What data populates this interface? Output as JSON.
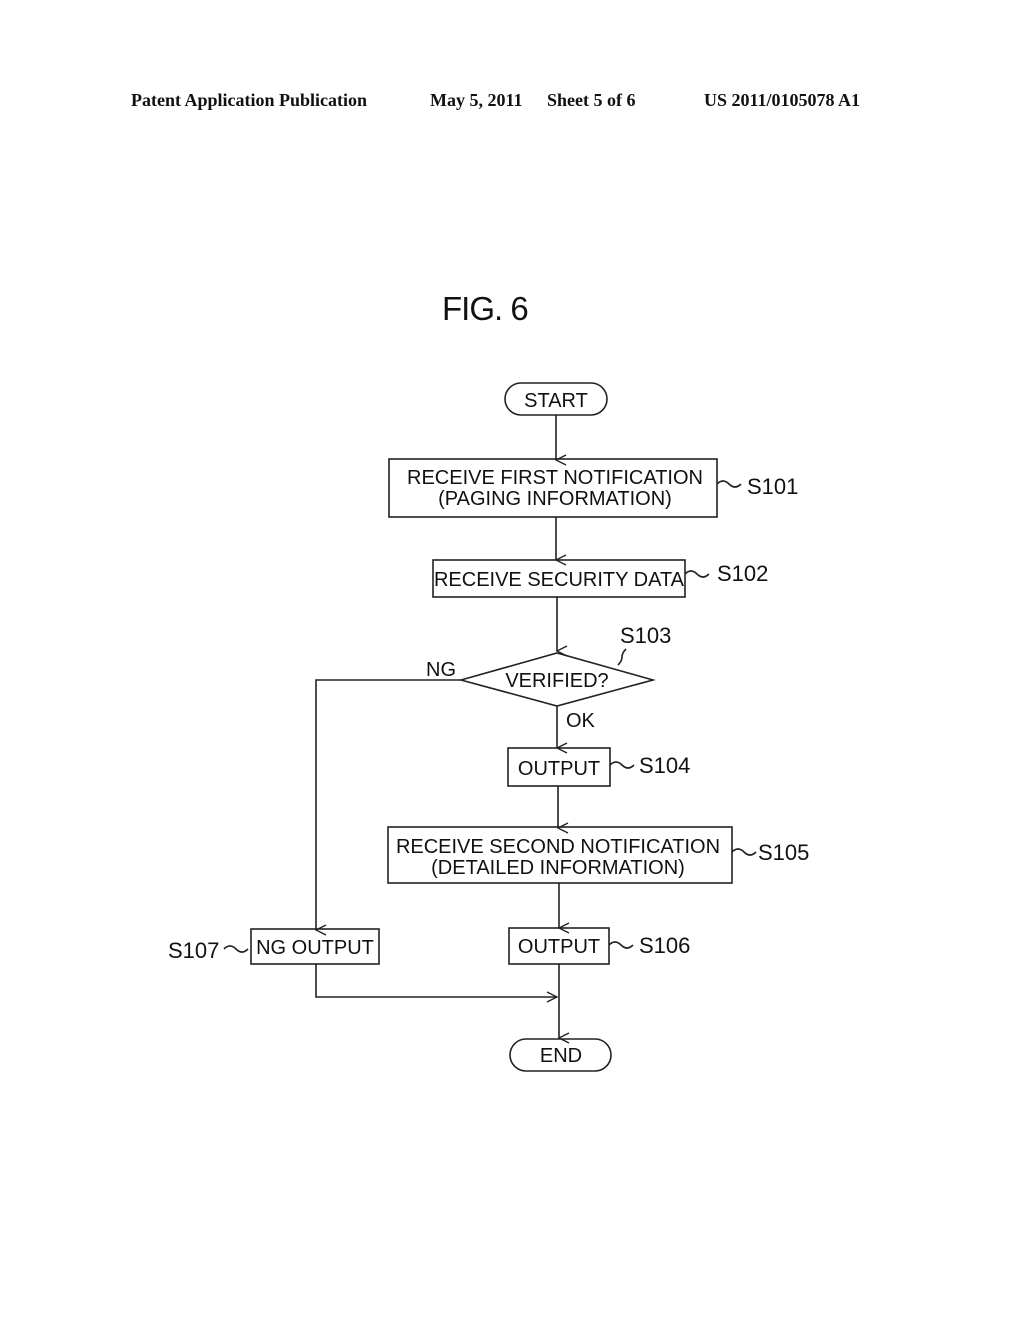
{
  "header": {
    "publication": "Patent Application Publication",
    "date": "May 5, 2011",
    "sheet": "Sheet 5 of 6",
    "number": "US 2011/0105078 A1"
  },
  "figure": {
    "title": "FIG. 6"
  },
  "flowchart": {
    "start": "START",
    "end": "END",
    "steps": {
      "s101": {
        "id": "S101",
        "line1": "RECEIVE FIRST NOTIFICATION",
        "line2": "(PAGING INFORMATION)"
      },
      "s102": {
        "id": "S102",
        "line1": "RECEIVE SECURITY DATA"
      },
      "s103": {
        "id": "S103",
        "line1": "VERIFIED?",
        "yes_label": "OK",
        "no_label": "NG"
      },
      "s104": {
        "id": "S104",
        "line1": "OUTPUT"
      },
      "s105": {
        "id": "S105",
        "line1": "RECEIVE SECOND NOTIFICATION",
        "line2": "(DETAILED INFORMATION)"
      },
      "s106": {
        "id": "S106",
        "line1": "OUTPUT"
      },
      "s107": {
        "id": "S107",
        "line1": "NG OUTPUT"
      }
    }
  }
}
